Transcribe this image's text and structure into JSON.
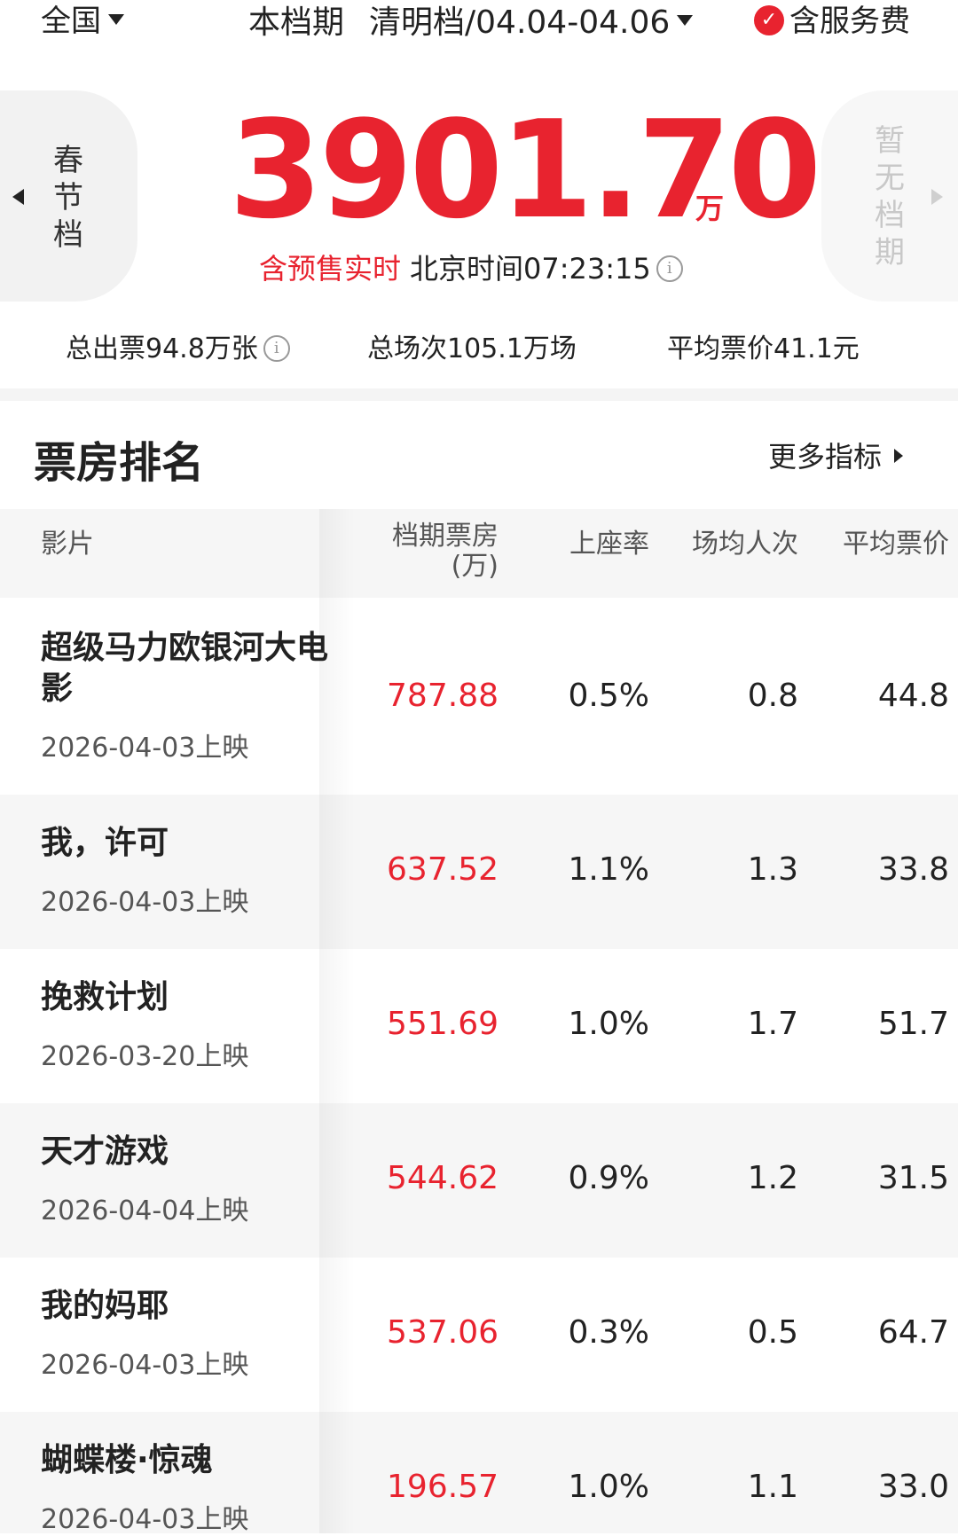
{
  "topbar": {
    "region": "全国",
    "period_label": "本档期",
    "period_value": "清明档/04.04-04.06",
    "service_label": "含服务费"
  },
  "hero": {
    "prev_period": "春节档",
    "next_period": "暂无档期",
    "total_box_office": "3901.70",
    "unit": "万",
    "realtime_label": "含预售实时",
    "beijing_time": "北京时间07:23:15"
  },
  "stats": {
    "tickets": "总出票94.8万张",
    "shows": "总场次105.1万场",
    "avg_price": "平均票价41.1元"
  },
  "ranking": {
    "title": "票房排名",
    "more": "更多指标",
    "columns": {
      "film": "影片",
      "box_office": "档期票房",
      "box_office_unit": "(万)",
      "seat_rate": "上座率",
      "avg_viewers": "场均人次",
      "avg_price": "平均票价"
    },
    "rows": [
      {
        "name": "超级马力欧银河大电影",
        "date": "2026-04-03上映",
        "box": "787.88",
        "seat": "0.5%",
        "avg": "0.8",
        "price": "44.8"
      },
      {
        "name": "我，许可",
        "date": "2026-04-03上映",
        "box": "637.52",
        "seat": "1.1%",
        "avg": "1.3",
        "price": "33.8"
      },
      {
        "name": "挽救计划",
        "date": "2026-03-20上映",
        "box": "551.69",
        "seat": "1.0%",
        "avg": "1.7",
        "price": "51.7"
      },
      {
        "name": "天才游戏",
        "date": "2026-04-04上映",
        "box": "544.62",
        "seat": "0.9%",
        "avg": "1.2",
        "price": "31.5"
      },
      {
        "name": "我的妈耶",
        "date": "2026-04-03上映",
        "box": "537.06",
        "seat": "0.3%",
        "avg": "0.5",
        "price": "64.7"
      },
      {
        "name": "蝴蝶楼·惊魂",
        "date": "2026-04-03上映",
        "box": "196.57",
        "seat": "1.0%",
        "avg": "1.1",
        "price": "33.0"
      }
    ]
  },
  "colors": {
    "accent": "#e8232f",
    "row_alt_bg": "#f6f6f6"
  }
}
